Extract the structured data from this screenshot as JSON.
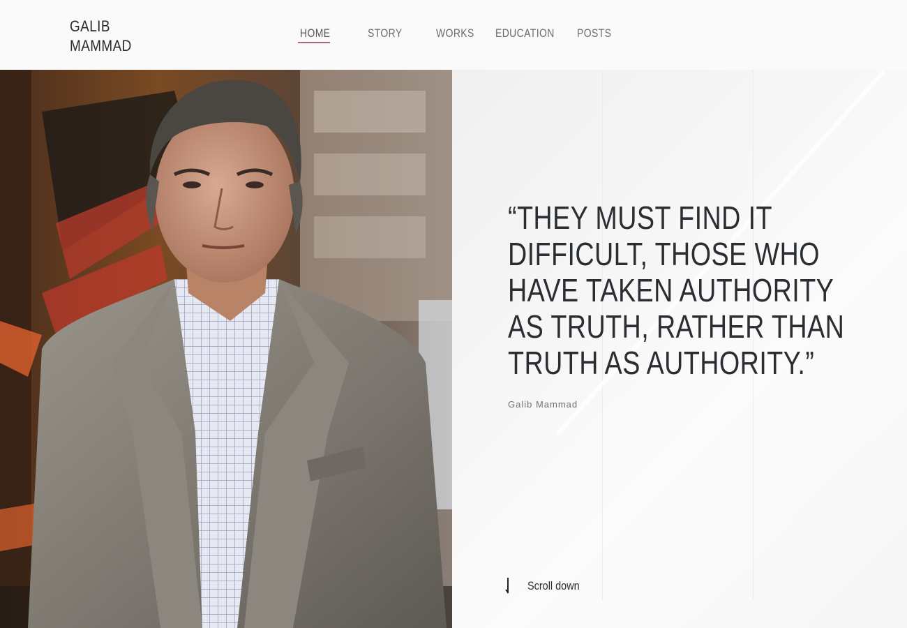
{
  "site": {
    "logo_line1": "GALIB",
    "logo_line2": "MAMMAD"
  },
  "nav": {
    "items": [
      {
        "label": "HOME",
        "active": true
      },
      {
        "label": "STORY",
        "active": false
      },
      {
        "label": "WORKS",
        "active": false
      },
      {
        "label": "EDUCATION",
        "active": false
      },
      {
        "label": "POSTS",
        "active": false
      }
    ],
    "accent_color": "#a56b72"
  },
  "hero": {
    "photo_icon": "portrait-photo",
    "quote": "“They must find it difficult, those who have taken authority as truth, rather than truth as authority.”",
    "author": "Galib Mammad",
    "scroll_label": "Scroll down",
    "scroll_icon": "arrow-down-icon"
  },
  "colors": {
    "text_dark": "#2a2e32",
    "background": "#f7f7f7"
  }
}
